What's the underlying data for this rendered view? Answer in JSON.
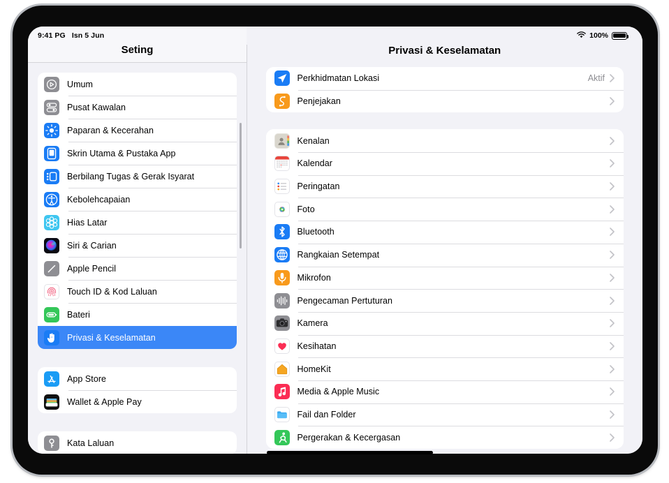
{
  "status_bar": {
    "time": "9:41 PG",
    "date": "Isn 5 Jun",
    "wifi_icon": "wifi-icon",
    "battery_percent": "100%",
    "battery_icon": "battery-full-icon"
  },
  "sidebar": {
    "title": "Seting",
    "groups": [
      {
        "items": [
          {
            "label": "Umum",
            "icon": "gear-general-icon",
            "selected": false
          },
          {
            "label": "Pusat Kawalan",
            "icon": "control-center-icon",
            "selected": false
          },
          {
            "label": "Paparan & Kecerahan",
            "icon": "display-brightness-icon",
            "selected": false
          },
          {
            "label": "Skrin Utama & Pustaka App",
            "icon": "home-screen-icon",
            "selected": false
          },
          {
            "label": "Berbilang Tugas & Gerak Isyarat",
            "icon": "multitasking-icon",
            "selected": false
          },
          {
            "label": "Kebolehcapaian",
            "icon": "accessibility-icon",
            "selected": false
          },
          {
            "label": "Hias Latar",
            "icon": "wallpaper-icon",
            "selected": false
          },
          {
            "label": "Siri & Carian",
            "icon": "siri-icon",
            "selected": false
          },
          {
            "label": "Apple Pencil",
            "icon": "apple-pencil-icon",
            "selected": false
          },
          {
            "label": "Touch ID & Kod Laluan",
            "icon": "touch-id-icon",
            "selected": false
          },
          {
            "label": "Bateri",
            "icon": "battery-icon",
            "selected": false
          },
          {
            "label": "Privasi & Keselamatan",
            "icon": "privacy-hand-icon",
            "selected": true
          }
        ]
      },
      {
        "items": [
          {
            "label": "App Store",
            "icon": "app-store-icon",
            "selected": false
          },
          {
            "label": "Wallet & Apple Pay",
            "icon": "wallet-icon",
            "selected": false
          }
        ]
      },
      {
        "items": [
          {
            "label": "Kata Laluan",
            "icon": "passwords-key-icon",
            "selected": false
          }
        ]
      }
    ]
  },
  "detail": {
    "title": "Privasi & Keselamatan",
    "groups": [
      {
        "items": [
          {
            "label": "Perkhidmatan Lokasi",
            "value": "Aktif",
            "icon": "location-arrow-icon"
          },
          {
            "label": "Penjejakan",
            "value": "",
            "icon": "tracking-icon"
          }
        ]
      },
      {
        "items": [
          {
            "label": "Kenalan",
            "value": "",
            "icon": "contacts-icon"
          },
          {
            "label": "Kalendar",
            "value": "",
            "icon": "calendar-icon"
          },
          {
            "label": "Peringatan",
            "value": "",
            "icon": "reminders-icon"
          },
          {
            "label": "Foto",
            "value": "",
            "icon": "photos-icon"
          },
          {
            "label": "Bluetooth",
            "value": "",
            "icon": "bluetooth-icon"
          },
          {
            "label": "Rangkaian Setempat",
            "value": "",
            "icon": "local-network-icon"
          },
          {
            "label": "Mikrofon",
            "value": "",
            "icon": "microphone-icon"
          },
          {
            "label": "Pengecaman Pertuturan",
            "value": "",
            "icon": "speech-recognition-icon"
          },
          {
            "label": "Kamera",
            "value": "",
            "icon": "camera-icon"
          },
          {
            "label": "Kesihatan",
            "value": "",
            "icon": "health-heart-icon"
          },
          {
            "label": "HomeKit",
            "value": "",
            "icon": "homekit-icon"
          },
          {
            "label": "Media & Apple Music",
            "value": "",
            "icon": "music-icon"
          },
          {
            "label": "Fail dan Folder",
            "value": "",
            "icon": "files-folder-icon"
          },
          {
            "label": "Pergerakan & Kecergasan",
            "value": "",
            "icon": "motion-fitness-icon"
          }
        ]
      }
    ]
  },
  "colors": {
    "accent_blue": "#3b87f7",
    "pane_background": "#f2f2f7",
    "row_background": "#ffffff",
    "secondary_text": "#8e8e93"
  }
}
